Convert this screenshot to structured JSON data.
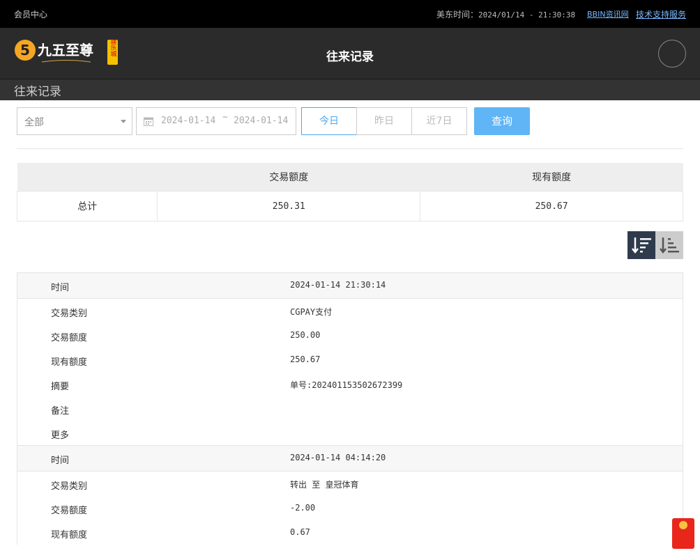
{
  "topbar": {
    "member_center": "会员中心",
    "time_label": "美东时间：",
    "time_value": "2024/01/14 - 21:30:38",
    "link1": "BBIN资讯网",
    "link2": "技术支持服务"
  },
  "header": {
    "logo_text": "九五至尊",
    "logo_sub": "娱乐城",
    "logo_num": "5",
    "title": "往来记录"
  },
  "subbar": {
    "title": "往来记录"
  },
  "filters": {
    "type_select": "全部",
    "date_start": "2024-01-14",
    "date_sep": "~",
    "date_end": "2024-01-14",
    "today": "今日",
    "yesterday": "昨日",
    "last7": "近7日",
    "search": "查询"
  },
  "summary": {
    "headers": [
      "",
      "交易额度",
      "现有额度"
    ],
    "total_label": "总计",
    "trade_amount": "250.31",
    "balance": "250.67"
  },
  "records": [
    {
      "time_label": "时间",
      "time": "2024-01-14 21:30:14",
      "type_label": "交易类别",
      "type": "CGPAY支付",
      "amount_label": "交易额度",
      "amount": "250.00",
      "balance_label": "现有额度",
      "balance": "250.67",
      "summary_label": "摘要",
      "summary": "单号:202401153502672399",
      "note_label": "备注",
      "note": "",
      "more_label": "更多"
    },
    {
      "time_label": "时间",
      "time": "2024-01-14 04:14:20",
      "type_label": "交易类别",
      "type": "转出 至 皇冠体育",
      "amount_label": "交易额度",
      "amount": "-2.00",
      "balance_label": "现有额度",
      "balance": "0.67"
    }
  ],
  "colors": {
    "accent": "#5fb5f5",
    "topbar": "#000000",
    "header": "#2b2b2b",
    "red_packet": "#e8261c"
  }
}
